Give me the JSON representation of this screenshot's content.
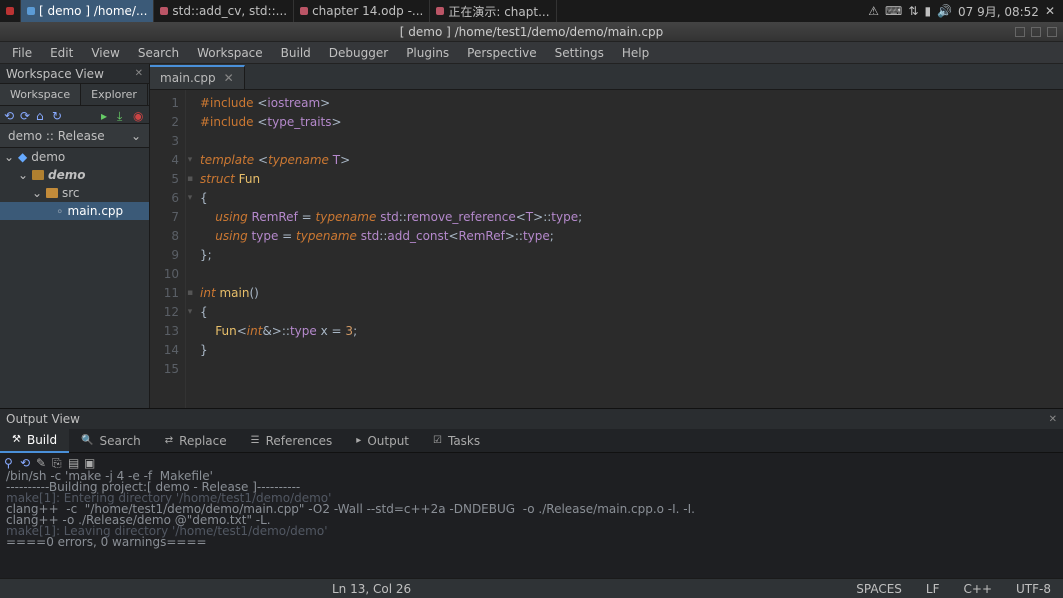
{
  "taskbar": {
    "items": [
      {
        "label": "[ demo ] /home/...",
        "active": true
      },
      {
        "label": "std::add_cv, std::..."
      },
      {
        "label": "chapter 14.odp -..."
      },
      {
        "label": "正在演示: chapt..."
      }
    ],
    "clock": "07 9月, 08:52"
  },
  "window": {
    "title": "[ demo ] /home/test1/demo/demo/main.cpp"
  },
  "menu": [
    "File",
    "Edit",
    "View",
    "Search",
    "Workspace",
    "Build",
    "Debugger",
    "Plugins",
    "Perspective",
    "Settings",
    "Help"
  ],
  "workspace": {
    "pane_title": "Workspace View",
    "tabs": [
      "Workspace",
      "Explorer"
    ],
    "config": "demo :: Release",
    "tree": {
      "root": "demo",
      "proj": "demo",
      "folder": "src",
      "file": "main.cpp"
    }
  },
  "editor": {
    "tab": "main.cpp",
    "lines": [
      {
        "n": 1,
        "html": "<span class='id'>#include</span> <span class='p'>&lt;</span><span class='t'>iostream</span><span class='p'>&gt;</span>"
      },
      {
        "n": 2,
        "html": "<span class='id'>#include</span> <span class='p'>&lt;</span><span class='t'>type_traits</span><span class='p'>&gt;</span>"
      },
      {
        "n": 3,
        "html": ""
      },
      {
        "n": 4,
        "html": "<span class='k'>template</span> <span class='p'>&lt;</span><span class='k'>typename</span> <span class='t'>T</span><span class='p'>&gt;</span>"
      },
      {
        "n": 5,
        "html": "<span class='k'>struct</span> <span class='fn'>Fun</span>"
      },
      {
        "n": 6,
        "html": "<span class='p'>{</span>"
      },
      {
        "n": 7,
        "html": "    <span class='k'>using</span> <span class='t'>RemRef</span> <span class='p'>=</span> <span class='k'>typename</span> <span class='t'>std</span><span class='p'>::</span><span class='t'>remove_reference</span><span class='p'>&lt;</span><span class='t'>T</span><span class='p'>&gt;::</span><span class='t'>type</span><span class='p'>;</span>"
      },
      {
        "n": 8,
        "html": "    <span class='k'>using</span> <span class='t'>type</span> <span class='p'>=</span> <span class='k'>typename</span> <span class='t'>std</span><span class='p'>::</span><span class='t'>add_const</span><span class='p'>&lt;</span><span class='t'>RemRef</span><span class='p'>&gt;::</span><span class='t'>type</span><span class='p'>;</span>"
      },
      {
        "n": 9,
        "html": "<span class='p'>};</span>"
      },
      {
        "n": 10,
        "html": ""
      },
      {
        "n": 11,
        "html": "<span class='k'>int</span> <span class='fn'>main</span><span class='p'>()</span>"
      },
      {
        "n": 12,
        "html": "<span class='p'>{</span>"
      },
      {
        "n": 13,
        "html": "    <span class='fn'>Fun</span><span class='p'>&lt;</span><span class='k'>int</span><span class='p'>&amp;&gt;::</span><span class='t'>type</span> <span class='p'>x</span> <span class='p'>=</span> <span class='n'>3</span><span class='p'>;</span>"
      },
      {
        "n": 14,
        "html": "<span class='p'>}</span>"
      },
      {
        "n": 15,
        "html": ""
      }
    ]
  },
  "output": {
    "pane_title": "Output View",
    "tabs": [
      {
        "label": "Build",
        "active": true
      },
      {
        "label": "Search"
      },
      {
        "label": "Replace"
      },
      {
        "label": "References"
      },
      {
        "label": "Output"
      },
      {
        "label": "Tasks"
      }
    ],
    "lines": [
      {
        "text": "/bin/sh -c 'make -j 4 -e -f  Makefile'"
      },
      {
        "text": "----------Building project:[ demo - Release ]----------"
      },
      {
        "text": "make[1]: Entering directory '/home/test1/demo/demo'",
        "dim": true
      },
      {
        "text": "clang++  -c  \"/home/test1/demo/demo/main.cpp\" -O2 -Wall --std=c++2a -DNDEBUG  -o ./Release/main.cpp.o -I. -I."
      },
      {
        "text": "clang++ -o ./Release/demo @\"demo.txt\" -L."
      },
      {
        "text": "make[1]: Leaving directory '/home/test1/demo/demo'",
        "dim": true
      },
      {
        "text": "====0 errors, 0 warnings===="
      }
    ]
  },
  "status": {
    "pos": "Ln 13, Col 26",
    "spaces": "SPACES",
    "eol": "LF",
    "lang": "C++",
    "enc": "UTF-8"
  }
}
